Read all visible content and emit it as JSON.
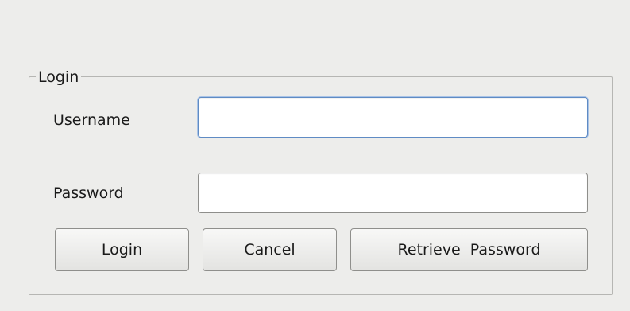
{
  "login_group": {
    "title": "Login",
    "username_label": "Username",
    "username_value": "",
    "password_label": "Password",
    "password_value": ""
  },
  "buttons": {
    "login": "Login",
    "cancel": "Cancel",
    "retrieve_password": "Retrieve  Password"
  },
  "colors": {
    "window_bg": "#ededeb",
    "focus_border": "#5f8bc4"
  }
}
